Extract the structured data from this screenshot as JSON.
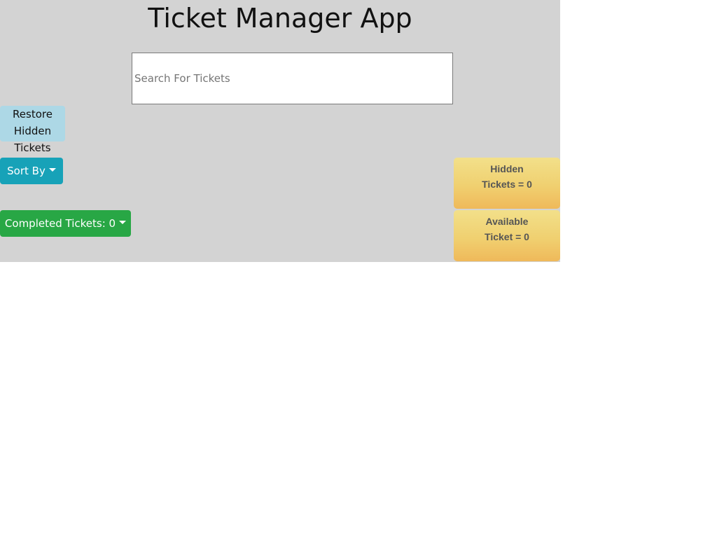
{
  "header": {
    "title": "Ticket Manager App"
  },
  "search": {
    "placeholder": "Search For Tickets",
    "value": ""
  },
  "controls": {
    "restore_line1": "Restore",
    "restore_line2": "Hidden",
    "restore_line3": "Tickets",
    "sort_label": "Sort By",
    "completed_label": "Completed Tickets: 0"
  },
  "stats": {
    "hidden_line1": "Hidden",
    "hidden_line2": "Tickets = 0",
    "available_line1": "Available",
    "available_line2": "Ticket = 0"
  },
  "colors": {
    "panel_bg": "#d3d3d3",
    "restore_bg": "#add8e6",
    "sort_bg": "#17a2b8",
    "completed_bg": "#28a745",
    "card_top": "#f2e08a",
    "card_bottom": "#efb95a"
  },
  "icons": {
    "sort_caret": "caret-down-icon",
    "completed_caret": "caret-down-icon"
  }
}
